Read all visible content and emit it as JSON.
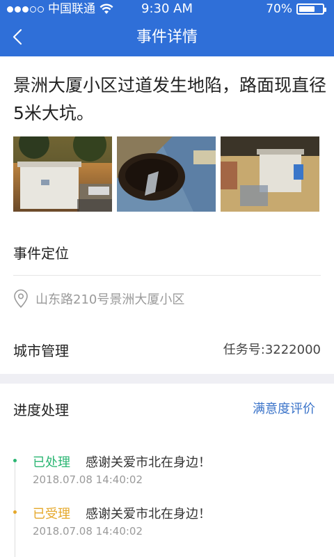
{
  "status_bar": {
    "carrier": "中国联通",
    "time": "9:30 AM",
    "battery_text": "70%",
    "battery_level": 0.7
  },
  "nav": {
    "title": "事件详情",
    "back_icon": "chevron-left-icon"
  },
  "event": {
    "title": "景洲大厦小区过道发生地陷，路面现直径5米大坑。"
  },
  "location": {
    "label": "事件定位",
    "address": "山东路210号景洲大厦小区",
    "icon": "location-pin-icon"
  },
  "category": {
    "label": "城市管理",
    "task_no": "任务号:3222000"
  },
  "progress": {
    "label": "进度处理",
    "rating_link": "满意度评价",
    "items": [
      {
        "status": "已处理",
        "message": "感谢关爱市北在身边！",
        "time": "2018.07.08 14:40:02",
        "color": "#2bb673"
      },
      {
        "status": "已受理",
        "message": "感谢关爱市北在身边！",
        "time": "2018.07.08 14:40:02",
        "color": "#e5a82b"
      }
    ]
  },
  "colors": {
    "header": "#2f6fd8",
    "link": "#3a73c9",
    "band": "#efeff4"
  }
}
